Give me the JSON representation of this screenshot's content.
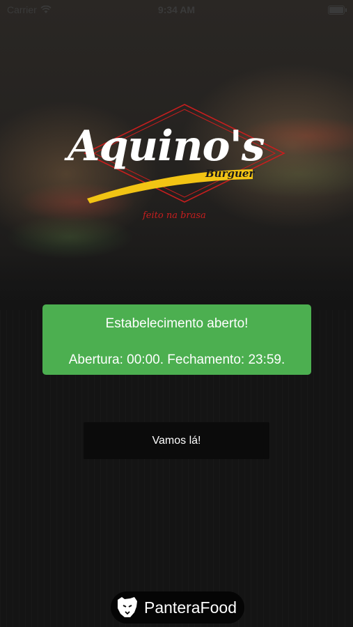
{
  "status_bar": {
    "carrier": "Carrier",
    "time": "9:34 AM"
  },
  "logo": {
    "script": "Aquino's",
    "burguer": "Burguer",
    "tagline": "feito na brasa",
    "colors": {
      "diamond": "#c81e1e",
      "swoosh": "#f2c414",
      "text": "#ffffff"
    }
  },
  "status_card": {
    "title": "Estabelecimento aberto!",
    "hours": "Abertura: 00:00. Fechamento: 23:59.",
    "color": "#4caf50"
  },
  "go_button": {
    "label": "Vamos lá!"
  },
  "footer": {
    "brand": "PanteraFood",
    "icon": "panther-icon"
  }
}
